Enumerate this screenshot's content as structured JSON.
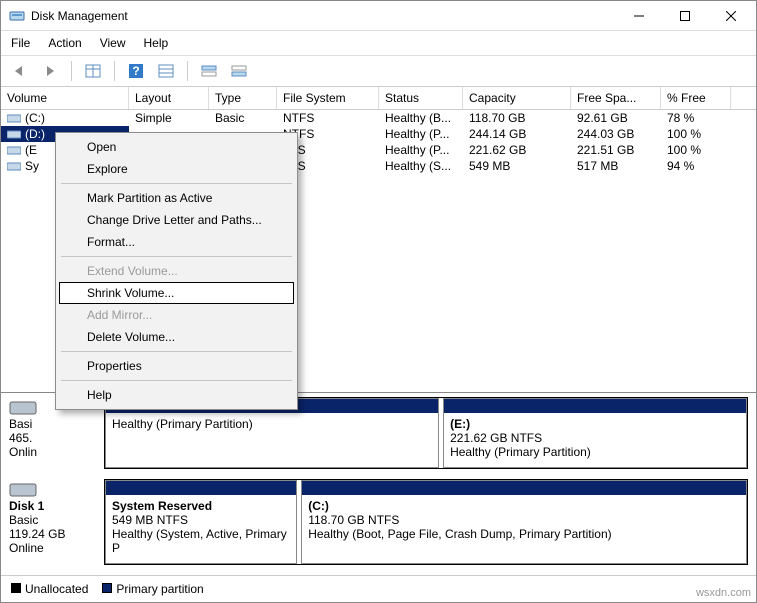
{
  "title": "Disk Management",
  "menus": {
    "file": "File",
    "action": "Action",
    "view": "View",
    "help": "Help"
  },
  "columns": {
    "volume": "Volume",
    "layout": "Layout",
    "type": "Type",
    "fs": "File System",
    "status": "Status",
    "capacity": "Capacity",
    "free": "Free Spa...",
    "pfree": "% Free"
  },
  "rows": [
    {
      "vol": "(C:)",
      "layout": "Simple",
      "type": "Basic",
      "fs": "NTFS",
      "status": "Healthy (B...",
      "cap": "118.70 GB",
      "free": "92.61 GB",
      "pfree": "78 %"
    },
    {
      "vol": "(D:)",
      "layout": "",
      "type": "",
      "fs": "NTFS",
      "status": "Healthy (P...",
      "cap": "244.14 GB",
      "free": "244.03 GB",
      "pfree": "100 %"
    },
    {
      "vol": "(E",
      "layout": "",
      "type": "",
      "fs": "TFS",
      "status": "Healthy (P...",
      "cap": "221.62 GB",
      "free": "221.51 GB",
      "pfree": "100 %"
    },
    {
      "vol": "Sy",
      "layout": "",
      "type": "",
      "fs": "TFS",
      "status": "Healthy (S...",
      "cap": "549 MB",
      "free": "517 MB",
      "pfree": "94 %"
    }
  ],
  "context": {
    "open": "Open",
    "explore": "Explore",
    "mark": "Mark Partition as Active",
    "change": "Change Drive Letter and Paths...",
    "format": "Format...",
    "extend": "Extend Volume...",
    "shrink": "Shrink Volume...",
    "mirror": "Add Mirror...",
    "delete": "Delete Volume...",
    "props": "Properties",
    "help": "Help"
  },
  "disk0": {
    "name": "Basi",
    "cap": "465.",
    "status": "Onlin",
    "p1": "Healthy (Primary Partition)",
    "p2name": "(E:)",
    "p2cap": "221.62 GB NTFS",
    "p2stat": "Healthy (Primary Partition)"
  },
  "disk1": {
    "name": "Disk 1",
    "type": "Basic",
    "cap": "119.24 GB",
    "status": "Online",
    "p1name": "System Reserved",
    "p1cap": "549 MB NTFS",
    "p1stat": "Healthy (System, Active, Primary P",
    "p2name": "(C:)",
    "p2cap": "118.70 GB NTFS",
    "p2stat": "Healthy (Boot, Page File, Crash Dump, Primary Partition)"
  },
  "legend": {
    "unalloc": "Unallocated",
    "primary": "Primary partition"
  },
  "watermark": "wsxdn.com"
}
